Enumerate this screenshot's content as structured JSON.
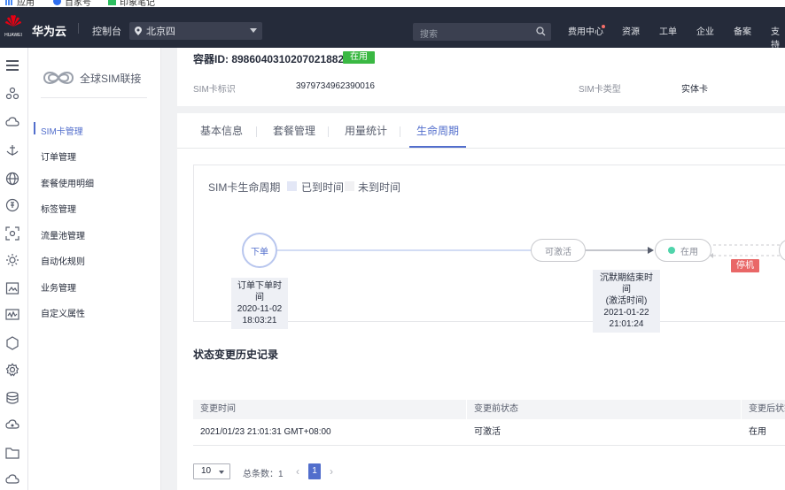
{
  "bookmarks": [
    "应用",
    "百家号",
    "印象笔记"
  ],
  "topnav": {
    "logo_text": "HUAWEI",
    "brand": "华为云",
    "console": "控制台",
    "region": "北京四",
    "search_placeholder": "搜索",
    "links": [
      "费用中心",
      "资源",
      "工单",
      "企业",
      "备案",
      "支持"
    ]
  },
  "sidebar": {
    "product_title": "全球SIM联接",
    "items": [
      "SIM卡管理",
      "订单管理",
      "套餐使用明细",
      "标签管理",
      "流量池管理",
      "自动化规则",
      "业务管理",
      "自定义属性"
    ]
  },
  "header": {
    "container_id": "容器ID: 89860403102070218828",
    "status": "在用",
    "sim_id_label": "SIM卡标识",
    "sim_id_value": "3979734962390016",
    "sim_type_label": "SIM卡类型",
    "sim_type_value": "实体卡"
  },
  "tabs": [
    "基本信息",
    "套餐管理",
    "用量统计",
    "生命周期"
  ],
  "lifecycle": {
    "title": "SIM卡生命周期",
    "legend_reached": "已到时间",
    "legend_not_reached": "未到时间",
    "node_order": "下单",
    "node_activatable": "可激活",
    "node_inuse": "在用",
    "tag_stopped": "停机",
    "tip1_line1": "订单下单时间",
    "tip1_line2": "2020-11-02",
    "tip1_line3": "18:03:21",
    "tip2_line1": "沉默期结束时间",
    "tip2_line2": "(激活时间)",
    "tip2_line3": "2021-01-22",
    "tip2_line4": "21:01:24"
  },
  "history": {
    "title": "状态变更历史记录",
    "columns": [
      "变更时间",
      "变更前状态",
      "变更后状态"
    ],
    "rows": [
      [
        "2021/01/23 21:01:31 GMT+08:00",
        "可激活",
        "在用"
      ]
    ]
  },
  "pager": {
    "page_size": "10",
    "total_label": "总条数：",
    "total": "1",
    "current_page": "1"
  },
  "colors": {
    "accent": "#526ecc",
    "nav_bg": "#252b3a",
    "status_green": "#3ab843",
    "stop_red": "#e96767"
  }
}
